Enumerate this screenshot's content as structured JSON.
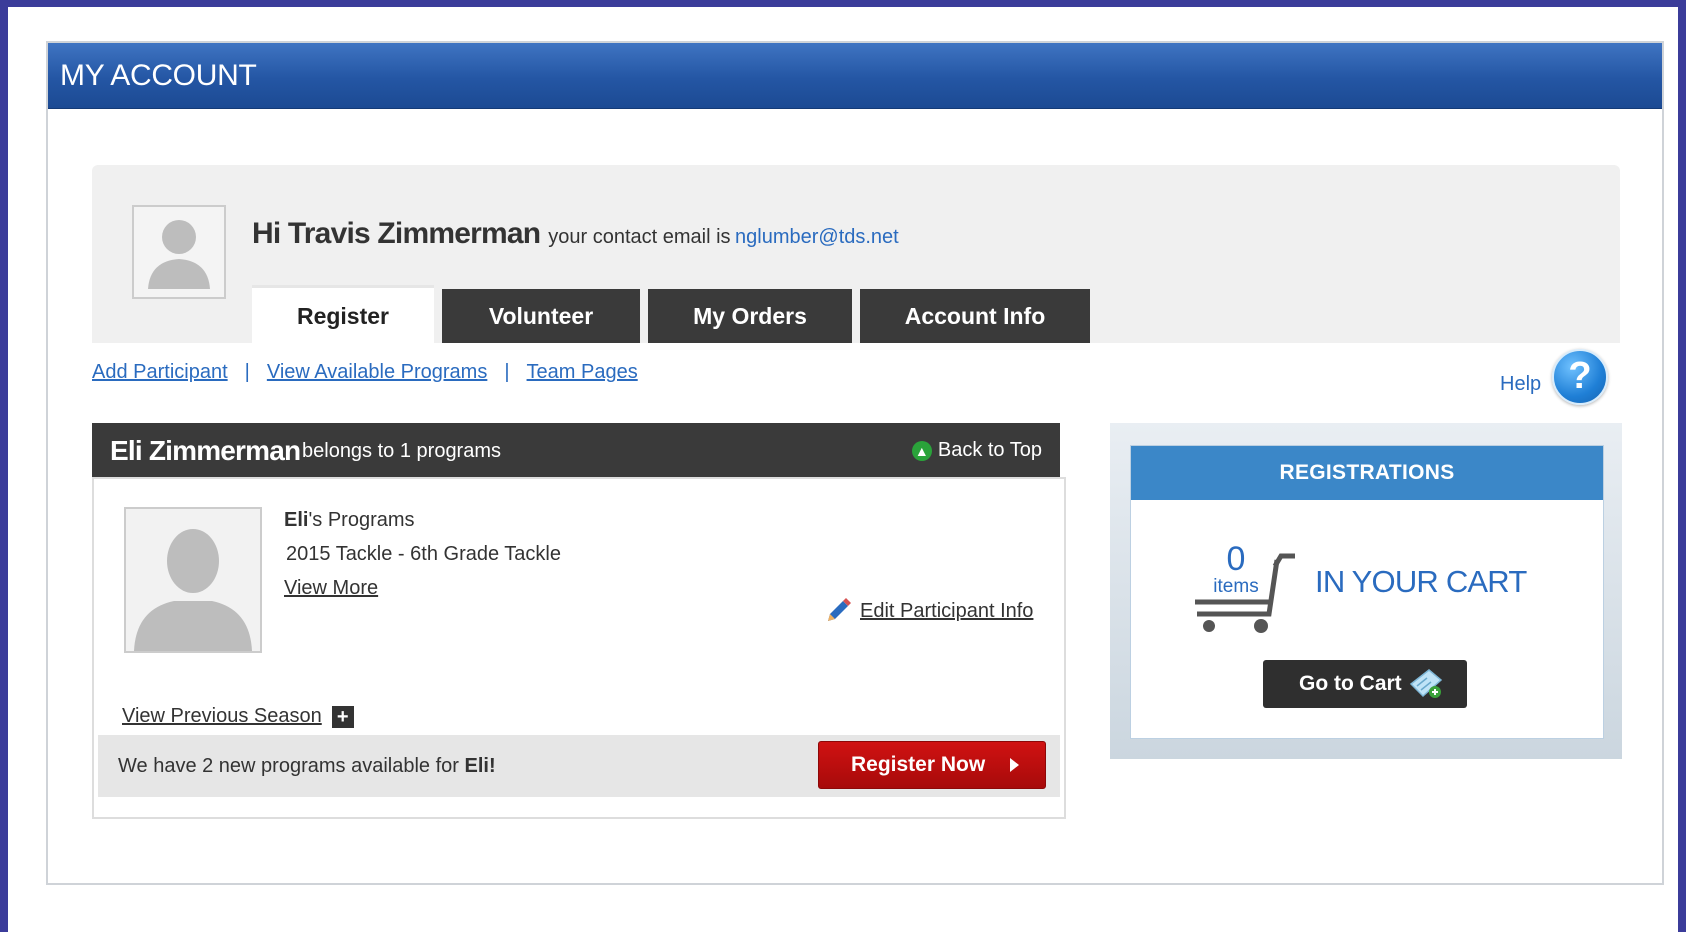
{
  "header": {
    "title": "MY ACCOUNT"
  },
  "user": {
    "greeting": "Hi Travis Zimmerman",
    "email_prefix": "your contact email is",
    "email": "nglumber@tds.net"
  },
  "tabs": [
    {
      "label": "Register",
      "active": true
    },
    {
      "label": "Volunteer",
      "active": false
    },
    {
      "label": "My Orders",
      "active": false
    },
    {
      "label": "Account Info",
      "active": false
    }
  ],
  "subnav": {
    "links": [
      "Add Participant",
      "View Available Programs",
      "Team Pages"
    ],
    "separator": "|",
    "help": "Help",
    "help_icon_glyph": "?"
  },
  "participant": {
    "name": "Eli Zimmerman",
    "belongs_text": "belongs to 1 programs",
    "back_to_top": "Back to Top",
    "programs_owner": "Eli",
    "programs_suffix": "'s Programs",
    "program": "2015 Tackle - 6th Grade Tackle",
    "view_more": "View More",
    "edit_info": "Edit Participant Info",
    "prev_season": "View Previous Season",
    "plus_glyph": "+",
    "new_programs_text": "We have 2 new programs available for",
    "new_programs_name": "Eli!",
    "register_now": "Register Now"
  },
  "registrations": {
    "title": "REGISTRATIONS",
    "count": "0",
    "items_label": "items",
    "in_cart": "IN YOUR CART",
    "go_to_cart": "Go to Cart"
  },
  "icons": {
    "avatar": "user-silhouette-icon",
    "back_to_top": "arrow-up-circle-icon",
    "edit": "pencil-icon",
    "expand": "plus-icon",
    "register_arrow": "triangle-right-icon",
    "cart": "shopping-cart-icon",
    "go_to_cart": "cart-badge-icon",
    "help": "question-circle-icon"
  },
  "colors": {
    "frame": "#3b3c9a",
    "header_blue": "#2456a4",
    "link_blue": "#2a6bbf",
    "tab_dark": "#3a3a3a",
    "register_red": "#c40f0f",
    "registrations_header": "#3b87c8"
  }
}
